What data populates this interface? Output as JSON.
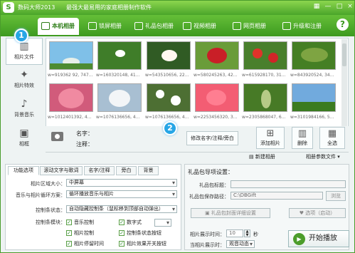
{
  "window": {
    "title": "数码大师2013",
    "subtitle": "最强大最易用的家庭相册制作软件"
  },
  "tabs": [
    "本机相册",
    "锁屏相册",
    "礼品包相册",
    "视频相册",
    "网页相册",
    "升级和注册"
  ],
  "sidebar": {
    "items": [
      "相片文件",
      "相片特效",
      "背景音乐",
      "相框"
    ]
  },
  "badges": {
    "first": "1",
    "second": "2"
  },
  "thumbs": [
    {
      "label": "w=919362 92, 747..."
    },
    {
      "label": "w=160320148, 41..."
    },
    {
      "label": "w=543510656, 22..."
    },
    {
      "label": "w=580245263, 42..."
    },
    {
      "label": "w=615928170, 31..."
    },
    {
      "label": "w=843920524, 34..."
    },
    {
      "label": "w=1012401392, 4..."
    },
    {
      "label": "w=1076136656, 4..."
    },
    {
      "label": "w=1076136656, 4..."
    },
    {
      "label": "w=2253456320, 3..."
    },
    {
      "label": "w=2305868047, 6..."
    },
    {
      "label": "w=3101984166, 5..."
    }
  ],
  "info": {
    "name_label": "名字：",
    "note_label": "注释：",
    "rename_button": "修改名字/注释/旁白",
    "add_button": "添加相片",
    "delete_button": "删除",
    "selectall_button": "全选"
  },
  "links": {
    "new_album": "新建相册",
    "album_settings": "相册参数文件"
  },
  "settings": {
    "tabs": [
      "功能选项",
      "滚动文字与歌词",
      "名字/注释",
      "旁白",
      "背景"
    ],
    "size_label": "相片区域大小：",
    "size_value": "中屏幕",
    "loop_label": "音乐与相片循环方案：",
    "loop_value": "循环播放音乐与相片",
    "panel_label": "控制条状态：",
    "panel_value": "自动隐藏控制条（鼠标移到顶部自动弹出）",
    "modules_label": "控制条模块：",
    "music": "音乐控制",
    "digits": "数字式",
    "photo": "相片控制",
    "status": "控制条状态按钮",
    "pause": "相片停留时间",
    "effect": "相片效果开关按钮"
  },
  "gift": {
    "title": "礼品包导项设置：",
    "title_label": "礼品包标题：",
    "path_label": "礼品包保存路径：",
    "path_value": "C:\\DBGift",
    "browse": "浏览",
    "detail": "礼品包封面详细设置",
    "options": "选项（启动）",
    "time_label": "相片展示时间：",
    "time_value": "10",
    "time_unit": "秒",
    "anim_label": "当相片展示时：",
    "anim_value": "观音动态"
  },
  "play_button": "开始播放"
}
